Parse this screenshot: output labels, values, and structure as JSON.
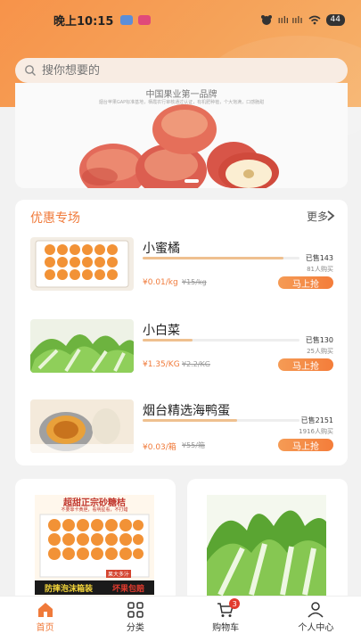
{
  "status_bar": {
    "time": "晚上10:15",
    "signal": "ıılı ıılı",
    "battery": "44"
  },
  "search": {
    "placeholder": "搜你想要的"
  },
  "banner": {
    "title": "中国果业第一品牌",
    "subtitle": "烟台苹果GAP标准基地，栖霞农行审核通过认证，有机肥种植，个大饱满，口感脆甜"
  },
  "promo": {
    "title": "优惠专场",
    "more_label": "更多",
    "items": [
      {
        "name": "小蜜橘",
        "sold": "已售143",
        "buyers": "81人购买",
        "progress": 0.9,
        "price": "¥0.01/kg",
        "old_price": "¥15/kg",
        "button": "马上抢"
      },
      {
        "name": "小白菜",
        "sold": "已售130",
        "buyers": "25人购买",
        "progress": 0.32,
        "price": "¥1.35/KG",
        "old_price": "¥2.2/KG",
        "button": "马上抢"
      },
      {
        "name": "烟台精选海鸭蛋",
        "sold": "已售2151",
        "buyers": "1916人购买",
        "progress": 0.6,
        "price": "¥0.03/箱",
        "old_price": "¥55/箱",
        "button": "马上抢"
      }
    ]
  },
  "grid": {
    "left_image_text": {
      "line1": "超甜正宗砂糖桔",
      "line2": "不要靠卡黄胆，看明星看，不打蜡",
      "line3": "防摔泡沫箱装",
      "line4": "坏果包赔",
      "line5": "果大多汁"
    }
  },
  "tabbar": {
    "items": [
      {
        "label": "首页"
      },
      {
        "label": "分类"
      },
      {
        "label": "购物车",
        "badge": "3"
      },
      {
        "label": "个人中心"
      }
    ]
  },
  "colors": {
    "accent": "#f07a3a",
    "header_gradient_start": "#f7934a",
    "progress": "#efc08f",
    "badge": "#e23b2e"
  }
}
